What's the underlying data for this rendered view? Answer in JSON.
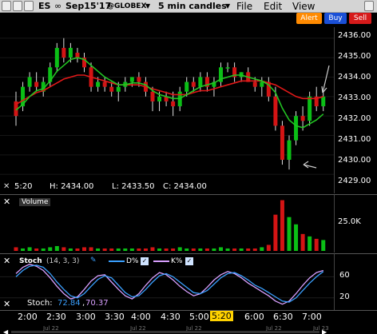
{
  "titlebar": {
    "symbol": "ES",
    "infinity": "∞",
    "contract": "Sep15'17",
    "exchange": "@GLOBEX",
    "dropdown": "▼",
    "interval": "5 min candles",
    "interval_dropdown": "▼",
    "menus": [
      "File",
      "Edit",
      "View"
    ]
  },
  "toolbar": {
    "alert_label": "Alert",
    "buy_label": "Buy",
    "sell_label": "Sell",
    "alert_color": "#ff8a00",
    "buy_color": "#1a4fd6",
    "sell_color": "#d61a1a"
  },
  "price_panel": {
    "y_ticks": [
      "2436.00",
      "2435.00",
      "2434.00",
      "2433.00",
      "2432.00",
      "2431.00",
      "2430.00",
      "2429.00"
    ],
    "info_time": "5:20",
    "info_high": "H:  2434.00",
    "info_low": "L:  2433.50",
    "info_close": "C:  2434.00"
  },
  "volume_panel": {
    "title": "Volume",
    "y_tick": "25.0K"
  },
  "stoch_panel": {
    "title": "Stoch",
    "params": "(14, 3, 3)",
    "d_label": "D%",
    "k_label": "K%",
    "y_ticks": [
      "60",
      "20"
    ],
    "readout_label": "Stoch:",
    "readout_d": "72.84",
    "readout_sep": ",",
    "readout_k": "70.37"
  },
  "x_axis": {
    "ticks": [
      "2:00",
      "2:30",
      "3:00",
      "3:30",
      "4:00",
      "4:30",
      "5:00",
      "5:20",
      "6:00",
      "6:30",
      "7:00"
    ],
    "dates": [
      "Jul 22",
      "Jul 22",
      "Jul 22",
      "Jul 22",
      "Jul 23"
    ]
  },
  "chart_data": {
    "type": "candlestick",
    "ylim": [
      2428.6,
      2436.4
    ],
    "candles": [
      {
        "o": 2432.75,
        "h": 2433.25,
        "l": 2431.5,
        "c": 2432.0
      },
      {
        "o": 2432.5,
        "h": 2433.75,
        "l": 2432.25,
        "c": 2433.5
      },
      {
        "o": 2433.5,
        "h": 2434.25,
        "l": 2433.25,
        "c": 2434.0
      },
      {
        "o": 2433.75,
        "h": 2434.25,
        "l": 2433.25,
        "c": 2433.5
      },
      {
        "o": 2433.25,
        "h": 2434.0,
        "l": 2433.0,
        "c": 2433.75
      },
      {
        "o": 2433.75,
        "h": 2434.75,
        "l": 2433.5,
        "c": 2434.5
      },
      {
        "o": 2434.5,
        "h": 2435.75,
        "l": 2434.25,
        "c": 2435.5
      },
      {
        "o": 2435.5,
        "h": 2436.0,
        "l": 2434.75,
        "c": 2435.0
      },
      {
        "o": 2435.0,
        "h": 2435.75,
        "l": 2434.75,
        "c": 2435.5
      },
      {
        "o": 2435.25,
        "h": 2435.5,
        "l": 2434.75,
        "c": 2435.0
      },
      {
        "o": 2435.0,
        "h": 2435.25,
        "l": 2434.25,
        "c": 2434.5
      },
      {
        "o": 2434.5,
        "h": 2434.75,
        "l": 2433.25,
        "c": 2433.5
      },
      {
        "o": 2433.5,
        "h": 2434.0,
        "l": 2433.25,
        "c": 2433.75
      },
      {
        "o": 2433.75,
        "h": 2434.0,
        "l": 2433.25,
        "c": 2433.5
      },
      {
        "o": 2433.5,
        "h": 2433.75,
        "l": 2433.0,
        "c": 2433.25
      },
      {
        "o": 2433.25,
        "h": 2433.75,
        "l": 2432.75,
        "c": 2433.5
      },
      {
        "o": 2433.5,
        "h": 2434.0,
        "l": 2433.25,
        "c": 2433.75
      },
      {
        "o": 2433.75,
        "h": 2434.0,
        "l": 2433.5,
        "c": 2434.0
      },
      {
        "o": 2434.0,
        "h": 2434.25,
        "l": 2433.5,
        "c": 2433.75
      },
      {
        "o": 2433.75,
        "h": 2434.0,
        "l": 2433.0,
        "c": 2433.25
      },
      {
        "o": 2433.25,
        "h": 2433.5,
        "l": 2432.25,
        "c": 2432.75
      },
      {
        "o": 2432.75,
        "h": 2433.25,
        "l": 2432.25,
        "c": 2433.0
      },
      {
        "o": 2433.0,
        "h": 2433.25,
        "l": 2432.5,
        "c": 2432.75
      },
      {
        "o": 2432.75,
        "h": 2433.25,
        "l": 2432.0,
        "c": 2432.5
      },
      {
        "o": 2432.5,
        "h": 2433.5,
        "l": 2432.25,
        "c": 2433.25
      },
      {
        "o": 2433.25,
        "h": 2434.0,
        "l": 2433.0,
        "c": 2433.75
      },
      {
        "o": 2433.75,
        "h": 2434.0,
        "l": 2433.25,
        "c": 2433.5
      },
      {
        "o": 2433.5,
        "h": 2434.25,
        "l": 2433.25,
        "c": 2434.0
      },
      {
        "o": 2434.0,
        "h": 2434.25,
        "l": 2433.25,
        "c": 2433.5
      },
      {
        "o": 2433.5,
        "h": 2434.0,
        "l": 2433.0,
        "c": 2433.75
      },
      {
        "o": 2433.75,
        "h": 2434.75,
        "l": 2433.5,
        "c": 2434.5
      },
      {
        "o": 2434.5,
        "h": 2434.75,
        "l": 2434.25,
        "c": 2434.5
      },
      {
        "o": 2434.5,
        "h": 2434.75,
        "l": 2433.75,
        "c": 2434.0
      },
      {
        "o": 2434.0,
        "h": 2434.25,
        "l": 2433.75,
        "c": 2434.25
      },
      {
        "o": 2434.25,
        "h": 2434.5,
        "l": 2433.75,
        "c": 2433.75
      },
      {
        "o": 2433.75,
        "h": 2434.0,
        "l": 2433.25,
        "c": 2433.5
      },
      {
        "o": 2433.5,
        "h": 2434.0,
        "l": 2433.0,
        "c": 2433.75
      },
      {
        "o": 2433.75,
        "h": 2434.0,
        "l": 2432.75,
        "c": 2433.0
      },
      {
        "o": 2433.0,
        "h": 2433.5,
        "l": 2431.25,
        "c": 2431.5
      },
      {
        "o": 2431.5,
        "h": 2431.75,
        "l": 2429.5,
        "c": 2429.75
      },
      {
        "o": 2429.75,
        "h": 2431.0,
        "l": 2429.25,
        "c": 2430.75
      },
      {
        "o": 2430.75,
        "h": 2432.25,
        "l": 2430.5,
        "c": 2432.0
      },
      {
        "o": 2432.0,
        "h": 2432.5,
        "l": 2431.25,
        "c": 2431.75
      },
      {
        "o": 2431.75,
        "h": 2433.25,
        "l": 2431.5,
        "c": 2433.0
      },
      {
        "o": 2433.0,
        "h": 2433.5,
        "l": 2432.25,
        "c": 2432.5
      },
      {
        "o": 2432.5,
        "h": 2433.25,
        "l": 2432.25,
        "c": 2433.0
      }
    ],
    "ma_fast": [
      2432.3,
      2432.6,
      2433.0,
      2433.3,
      2433.4,
      2433.8,
      2434.3,
      2434.6,
      2434.9,
      2435.0,
      2434.9,
      2434.6,
      2434.3,
      2434.0,
      2433.8,
      2433.6,
      2433.6,
      2433.7,
      2433.7,
      2433.6,
      2433.3,
      2433.1,
      2433.0,
      2432.9,
      2432.9,
      2433.1,
      2433.3,
      2433.5,
      2433.6,
      2433.7,
      2433.9,
      2434.0,
      2434.1,
      2434.1,
      2434.0,
      2433.9,
      2433.8,
      2433.6,
      2433.2,
      2432.4,
      2431.8,
      2431.5,
      2431.4,
      2431.6,
      2431.8,
      2432.1
    ],
    "ma_slow": [
      2432.6,
      2432.8,
      2433.0,
      2433.2,
      2433.3,
      2433.5,
      2433.7,
      2433.9,
      2434.0,
      2434.1,
      2434.1,
      2434.0,
      2433.9,
      2433.8,
      2433.7,
      2433.6,
      2433.6,
      2433.6,
      2433.6,
      2433.5,
      2433.4,
      2433.3,
      2433.2,
      2433.1,
      2433.1,
      2433.1,
      2433.2,
      2433.3,
      2433.3,
      2433.4,
      2433.5,
      2433.6,
      2433.7,
      2433.8,
      2433.8,
      2433.8,
      2433.8,
      2433.7,
      2433.6,
      2433.4,
      2433.2,
      2433.0,
      2432.9,
      2432.9,
      2432.9,
      2433.0
    ],
    "volume": [
      3,
      2,
      3,
      2,
      2,
      3,
      4,
      3,
      2,
      2,
      3,
      3,
      2,
      2,
      2,
      2,
      2,
      2,
      2,
      2,
      3,
      2,
      2,
      2,
      3,
      2,
      2,
      2,
      2,
      2,
      3,
      2,
      2,
      2,
      2,
      2,
      3,
      5,
      30,
      42,
      28,
      22,
      14,
      12,
      10,
      9
    ],
    "volume_max": 45,
    "stoch_d": [
      60,
      72,
      80,
      82,
      78,
      66,
      50,
      36,
      24,
      20,
      28,
      42,
      55,
      62,
      58,
      44,
      30,
      22,
      24,
      36,
      50,
      62,
      66,
      60,
      50,
      40,
      30,
      28,
      34,
      46,
      58,
      66,
      68,
      62,
      54,
      44,
      38,
      30,
      22,
      14,
      12,
      20,
      34,
      48,
      60,
      70
    ],
    "stoch_k": [
      66,
      78,
      84,
      80,
      72,
      58,
      42,
      28,
      18,
      22,
      36,
      52,
      62,
      64,
      50,
      36,
      24,
      18,
      28,
      44,
      58,
      68,
      64,
      54,
      42,
      32,
      24,
      28,
      40,
      54,
      64,
      70,
      66,
      58,
      48,
      40,
      32,
      24,
      14,
      8,
      14,
      28,
      44,
      58,
      68,
      72
    ],
    "stoch_ylim": [
      0,
      100
    ],
    "colors": {
      "up": "#0bbf16",
      "down": "#d41414",
      "ma_fast": "#22c322",
      "ma_slow": "#e01818",
      "stoch_d": "#3aa0ff",
      "stoch_k": "#d9a0ff",
      "volume_up": "#0bbf16",
      "volume_down": "#d41414"
    }
  }
}
